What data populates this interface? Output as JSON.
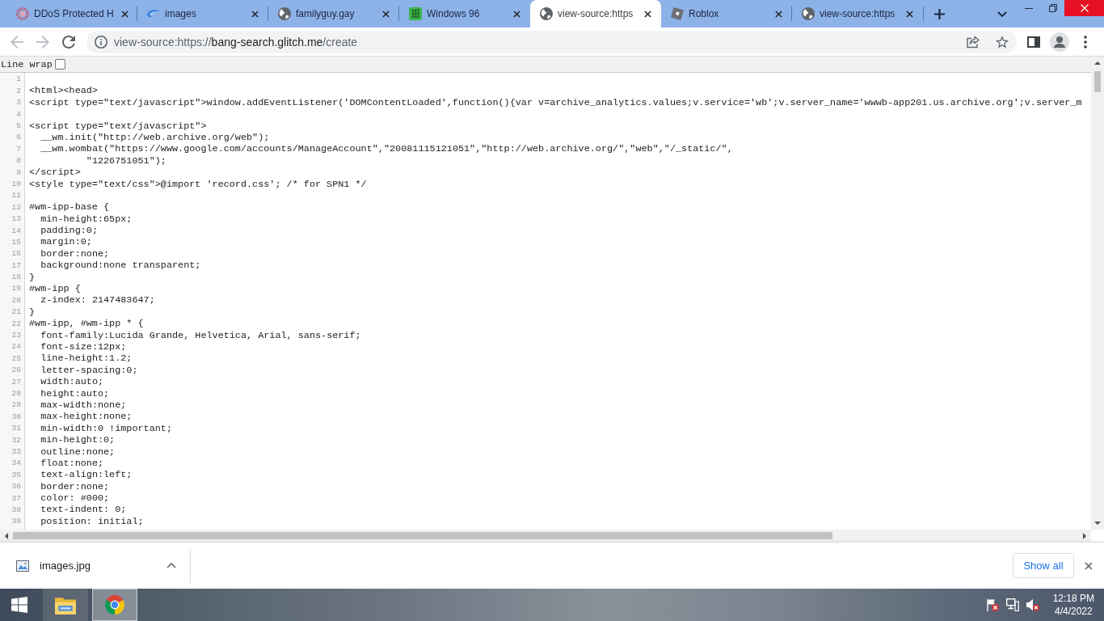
{
  "tab_strip": {
    "tabs": [
      {
        "title": "DDoS Protected H",
        "selected": false
      },
      {
        "title": "images",
        "selected": false
      },
      {
        "title": "familyguy.gay",
        "selected": false
      },
      {
        "title": "Windows 96",
        "selected": false
      },
      {
        "title": "view-source:https",
        "selected": true
      },
      {
        "title": "Roblox",
        "selected": false
      },
      {
        "title": "view-source:https",
        "selected": false
      }
    ]
  },
  "toolbar": {
    "back": {
      "disabled": true
    },
    "forward": {
      "disabled": true
    },
    "address": {
      "scheme": "view-source:https://",
      "host": "bang-search.glitch.me",
      "path": "/create"
    }
  },
  "source_view": {
    "line_wrap": {
      "label": "Line wrap",
      "checked": false
    },
    "lines": [
      {
        "number": "1"
      },
      {
        "number": "2",
        "text": "<html><head>"
      },
      {
        "number": "3",
        "text": "<script type=\"text/javascript\">window.addEventListener('DOMContentLoaded',function(){var v=archive_analytics.values;v.service='wb';v.server_name='wwwb-app201.us.archive.org';v.server_m"
      },
      {
        "number": "4"
      },
      {
        "number": "5",
        "text": "<script type=\"text/javascript\">"
      },
      {
        "number": "6",
        "text": "  __wm.init(\"http://web.archive.org/web\");"
      },
      {
        "number": "7",
        "text": "  __wm.wombat(\"https://www.google.com/accounts/ManageAccount\",\"20081115121051\",\"http://web.archive.org/\",\"web\",\"/_static/\","
      },
      {
        "number": "8",
        "text": "          \"1226751051\");"
      },
      {
        "number": "9",
        "text": "</script>"
      },
      {
        "number": "10",
        "text": "<style type=\"text/css\">@import 'record.css'; /* for SPN1 */"
      },
      {
        "number": "11"
      },
      {
        "number": "12",
        "text": "#wm-ipp-base {"
      },
      {
        "number": "13",
        "text": "  min-height:65px;"
      },
      {
        "number": "14",
        "text": "  padding:0;"
      },
      {
        "number": "15",
        "text": "  margin:0;"
      },
      {
        "number": "16",
        "text": "  border:none;"
      },
      {
        "number": "17",
        "text": "  background:none transparent;"
      },
      {
        "number": "18",
        "text": "}"
      },
      {
        "number": "19",
        "text": "#wm-ipp {"
      },
      {
        "number": "20",
        "text": "  z-index: 2147483647;"
      },
      {
        "number": "21",
        "text": "}"
      },
      {
        "number": "22",
        "text": "#wm-ipp, #wm-ipp * {"
      },
      {
        "number": "23",
        "text": "  font-family:Lucida Grande, Helvetica, Arial, sans-serif;"
      },
      {
        "number": "24",
        "text": "  font-size:12px;"
      },
      {
        "number": "25",
        "text": "  line-height:1.2;"
      },
      {
        "number": "26",
        "text": "  letter-spacing:0;"
      },
      {
        "number": "27",
        "text": "  width:auto;"
      },
      {
        "number": "28",
        "text": "  height:auto;"
      },
      {
        "number": "29",
        "text": "  max-width:none;"
      },
      {
        "number": "30",
        "text": "  max-height:none;"
      },
      {
        "number": "31",
        "text": "  min-width:0 !important;"
      },
      {
        "number": "32",
        "text": "  min-height:0;"
      },
      {
        "number": "33",
        "text": "  outline:none;"
      },
      {
        "number": "34",
        "text": "  float:none;"
      },
      {
        "number": "35",
        "text": "  text-align:left;"
      },
      {
        "number": "36",
        "text": "  border:none;"
      },
      {
        "number": "37",
        "text": "  color: #000;"
      },
      {
        "number": "38",
        "text": "  text-indent: 0;"
      },
      {
        "number": "39",
        "text": "  position: initial;"
      }
    ]
  },
  "download_bar": {
    "file": "images.jpg",
    "show_all": "Show all"
  },
  "taskbar": {
    "apps": [
      {
        "active": false
      },
      {
        "active": true
      }
    ],
    "clock": {
      "time": "12:18 PM",
      "date": "4/4/2022"
    }
  }
}
